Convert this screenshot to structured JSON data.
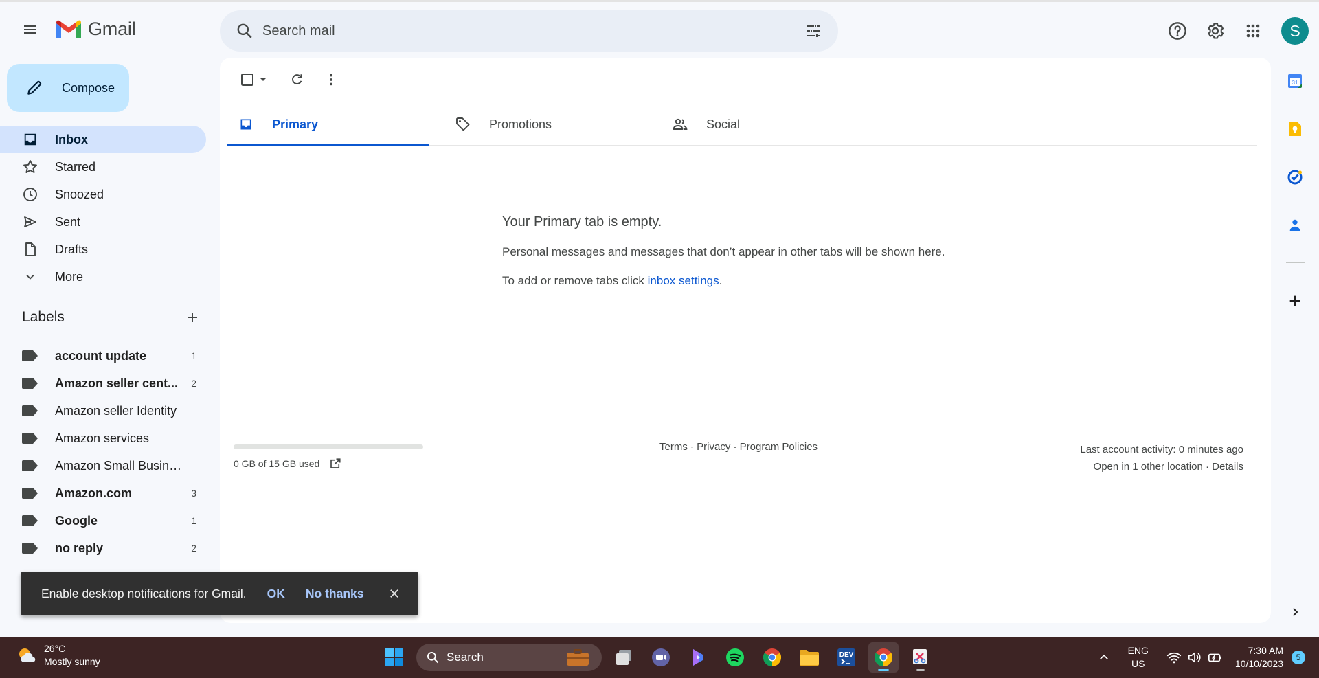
{
  "app": {
    "name": "Gmail",
    "avatar_letter": "S"
  },
  "search": {
    "placeholder": "Search mail"
  },
  "compose": {
    "label": "Compose"
  },
  "nav": [
    {
      "label": "Inbox",
      "icon": "inbox-icon",
      "active": true
    },
    {
      "label": "Starred",
      "icon": "star-icon"
    },
    {
      "label": "Snoozed",
      "icon": "clock-icon"
    },
    {
      "label": "Sent",
      "icon": "send-icon"
    },
    {
      "label": "Drafts",
      "icon": "draft-icon"
    },
    {
      "label": "More",
      "icon": "chevron-down-icon"
    }
  ],
  "labels": {
    "title": "Labels",
    "items": [
      {
        "name": "account update",
        "count": "1",
        "bold": true
      },
      {
        "name": "Amazon seller cent...",
        "count": "2",
        "bold": true
      },
      {
        "name": "Amazon seller Identity",
        "count": "",
        "bold": false
      },
      {
        "name": "Amazon services",
        "count": "",
        "bold": false
      },
      {
        "name": "Amazon Small Business",
        "count": "",
        "bold": false
      },
      {
        "name": "Amazon.com",
        "count": "3",
        "bold": true
      },
      {
        "name": "Google",
        "count": "1",
        "bold": true
      },
      {
        "name": "no reply",
        "count": "2",
        "bold": true
      }
    ]
  },
  "tabs": [
    {
      "label": "Primary",
      "icon": "inbox-icon",
      "active": true
    },
    {
      "label": "Promotions",
      "icon": "tag-icon"
    },
    {
      "label": "Social",
      "icon": "people-icon"
    }
  ],
  "empty": {
    "title": "Your Primary tab is empty.",
    "line1": "Personal messages and messages that don’t appear in other tabs will be shown here.",
    "line2_prefix": "To add or remove tabs click ",
    "line2_link": "inbox settings",
    "line2_suffix": "."
  },
  "footer": {
    "storage": "0 GB of 15 GB used",
    "storage_used_fraction": 0,
    "links": "Terms · Privacy · Program Policies",
    "activity": "Last account activity: 0 minutes ago",
    "location": "Open in 1 other location · Details"
  },
  "snackbar": {
    "message": "Enable desktop notifications for Gmail.",
    "ok": "OK",
    "no_thanks": "No thanks"
  },
  "taskbar": {
    "temperature": "26°C",
    "condition": "Mostly sunny",
    "search_label": "Search",
    "lang_top": "ENG",
    "lang_bottom": "US",
    "time": "7:30 AM",
    "date": "10/10/2023",
    "notifications": "5"
  },
  "colors": {
    "accent": "#0b57d0",
    "compose_bg": "#c2e7ff",
    "active_nav": "#d3e3fd",
    "avatar_bg": "#0e8c8e",
    "taskbar_bg": "#3d2424"
  }
}
